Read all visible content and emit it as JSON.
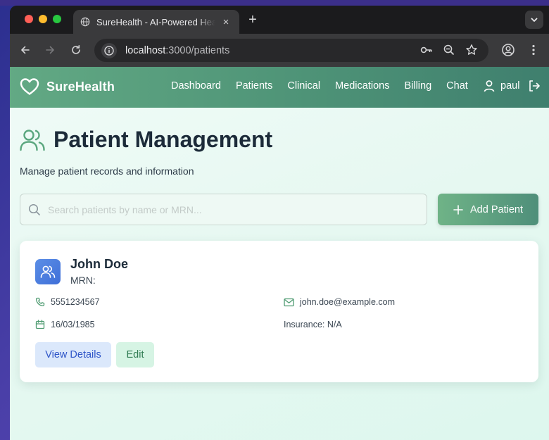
{
  "browser": {
    "tab_title": "SureHealth - AI-Powered Hea",
    "tab_close": "×",
    "new_tab": "+",
    "url_host": "localhost",
    "url_path": ":3000/patients"
  },
  "app": {
    "brand": "SureHealth",
    "nav": [
      "Dashboard",
      "Patients",
      "Clinical",
      "Medications",
      "Billing",
      "Chat"
    ],
    "user": "paul"
  },
  "page": {
    "title": "Patient Management",
    "subtitle": "Manage patient records and information",
    "search_placeholder": "Search patients by name or MRN...",
    "add_button": "Add Patient"
  },
  "patients": [
    {
      "name": "John Doe",
      "mrn": "MRN:",
      "phone": "5551234567",
      "email": "john.doe@example.com",
      "dob": "16/03/1985",
      "insurance": "Insurance: N/A",
      "view_label": "View Details",
      "edit_label": "Edit"
    }
  ],
  "colors": {
    "brand_gradient_start": "#62a984",
    "brand_gradient_end": "#3f7f6e",
    "primary_text": "#1c2b39",
    "view_button_bg": "#dbe8fb",
    "edit_button_bg": "#d6f4e4"
  }
}
